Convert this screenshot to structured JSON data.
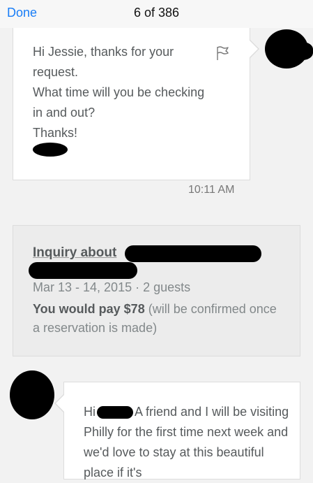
{
  "topbar": {
    "done_label": "Done",
    "counter": "6 of 386"
  },
  "message1": {
    "lines": "Hi Jessie, thanks for your\nrequest.\nWhat time will you be checking\nin and out?\nThanks!",
    "time": "10:11 AM",
    "flag_icon": "flag-icon"
  },
  "inquiry": {
    "title": "Inquiry about",
    "dates_guests": "Mar 13 - 14, 2015 · 2 guests",
    "pay_bold": "You would pay $78",
    "pay_rest": " (will be confirmed once a reservation is made)"
  },
  "message2": {
    "hi": "Hi",
    "text": "A friend and I will be visiting Philly for the first time next week and we'd love to stay at this beautiful place if it's"
  },
  "colors": {
    "accent": "#1a7ef7",
    "background": "#f2f2f2",
    "card_border": "#dcdcdc",
    "redaction": "#000000"
  }
}
